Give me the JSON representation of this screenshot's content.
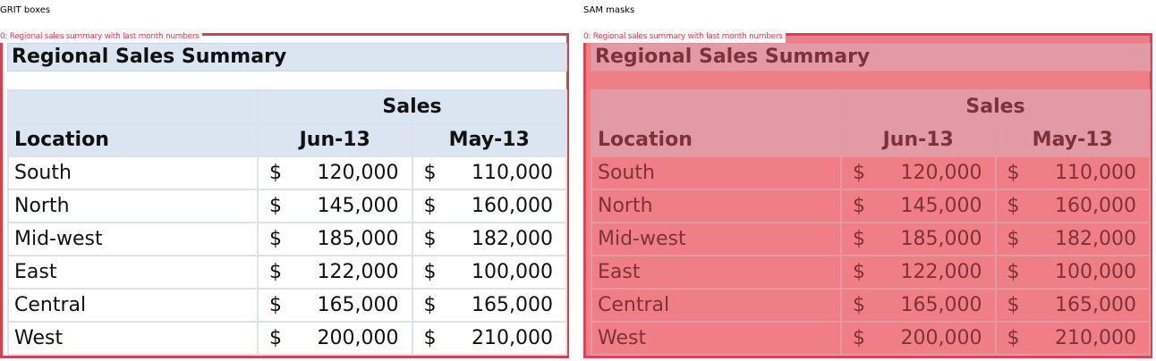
{
  "panels": [
    {
      "title": "GRIT boxes",
      "box_label": "0: Regional sales summary with last month numbers"
    },
    {
      "title": "SAM masks",
      "box_label": "0: Regional sales summary with last month numbers"
    }
  ],
  "sheet": {
    "title": "Regional Sales Summary",
    "group_header": "Sales",
    "col_location": "Location",
    "col_month1": "Jun-13",
    "col_month2": "May-13",
    "currency": "$",
    "rows": [
      {
        "location": "South",
        "m1": "120,000",
        "m2": "110,000"
      },
      {
        "location": "North",
        "m1": "145,000",
        "m2": "160,000"
      },
      {
        "location": "Mid-west",
        "m1": "185,000",
        "m2": "182,000"
      },
      {
        "location": "East",
        "m1": "122,000",
        "m2": "100,000"
      },
      {
        "location": "Central",
        "m1": "165,000",
        "m2": "165,000"
      },
      {
        "location": "West",
        "m1": "200,000",
        "m2": "210,000"
      }
    ]
  },
  "colors": {
    "box_outline": "#d24350",
    "mask_fill": "#f07880",
    "header_fill": "#dbe5f1"
  }
}
